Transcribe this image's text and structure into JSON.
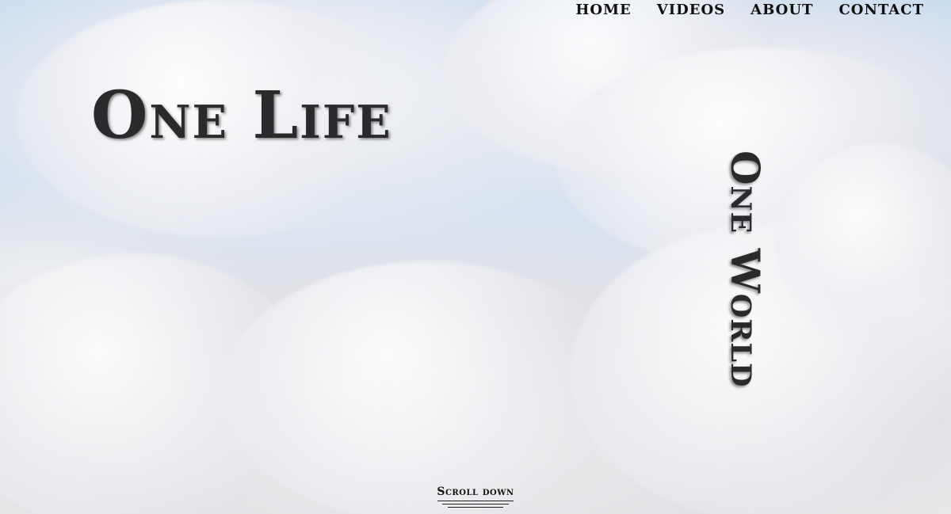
{
  "nav": {
    "items": [
      {
        "label": "HOME"
      },
      {
        "label": "VIDEOS"
      },
      {
        "label": "ABOUT"
      },
      {
        "label": "CONTACT"
      }
    ]
  },
  "hero": {
    "title_left": "One Life",
    "title_vertical": "One World",
    "scroll_label": "Scroll down"
  },
  "colors": {
    "text": "#2a292b",
    "nav_text": "#111111",
    "sky": "#c7dbef"
  }
}
